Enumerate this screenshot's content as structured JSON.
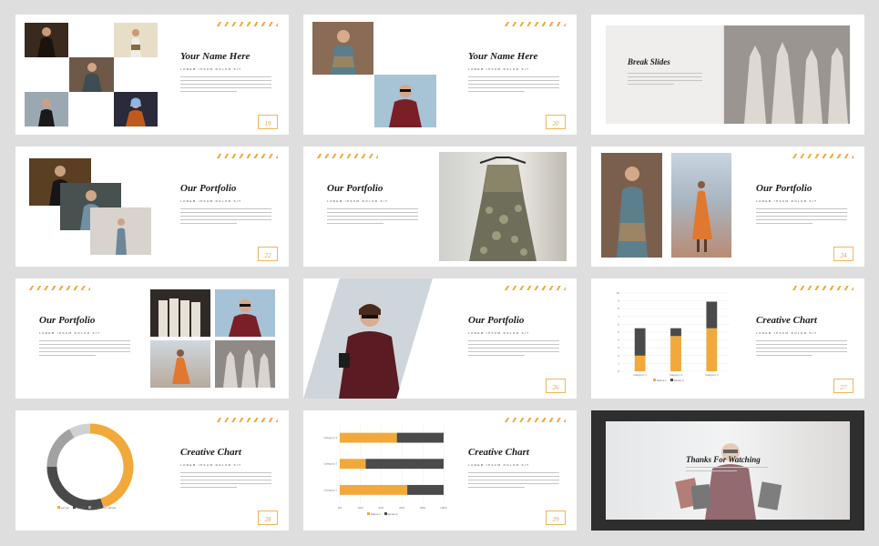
{
  "colors": {
    "accent": "#f2a93b",
    "dark": "#4a4a4a",
    "light": "#cfd3d0",
    "grid": "#ececec"
  },
  "common": {
    "subtitle": "LOREM IPSUM DOLOR SIT"
  },
  "slides": {
    "s1": {
      "title": "Your Name Here",
      "number": "19"
    },
    "s2": {
      "title": "Your Name Here",
      "number": "20"
    },
    "s3": {
      "title": "Break Slides"
    },
    "s4": {
      "title": "Our Portfolio",
      "number": "22"
    },
    "s5": {
      "title": "Our Portfolio"
    },
    "s6": {
      "title": "Our Portfolio",
      "number": "24"
    },
    "s7": {
      "title": "Our Portfolio"
    },
    "s8": {
      "title": "Our Portfolio",
      "number": "26"
    },
    "s9": {
      "title": "Creative Chart",
      "number": "27"
    },
    "s10": {
      "title": "Creative Chart",
      "number": "28"
    },
    "s11": {
      "title": "Creative Chart",
      "number": "29"
    },
    "s12": {
      "title": "Thanks For Watching"
    }
  },
  "chart_data": [
    {
      "type": "bar",
      "stacked": true,
      "categories": [
        "Category 1",
        "Category 2",
        "Category 3"
      ],
      "series": [
        {
          "name": "Series 1",
          "values": [
            2,
            4.5,
            5.5
          ],
          "color": "#f2a93b"
        },
        {
          "name": "Series 2",
          "values": [
            3.5,
            1,
            3.4
          ],
          "color": "#4a4a4a"
        }
      ],
      "ylim": [
        0,
        10
      ],
      "yticks": [
        "0",
        "1",
        "2",
        "3",
        "4",
        "5",
        "6",
        "7",
        "8",
        "9",
        "10"
      ],
      "grid": true,
      "legend": "bottom"
    },
    {
      "type": "pie",
      "donut": true,
      "categories": [
        "1st Qtr",
        "2nd Qtr",
        "3rd Qtr",
        "4th Qtr"
      ],
      "values": [
        45,
        30,
        17,
        8
      ],
      "colors": [
        "#f2a93b",
        "#4a4a4a",
        "#a2a2a2",
        "#cfd3d0"
      ],
      "legend": "bottom"
    },
    {
      "type": "bar",
      "orientation": "horizontal",
      "stacked": true,
      "percent": true,
      "categories": [
        "Category 1",
        "Category 2",
        "Category 3"
      ],
      "series": [
        {
          "name": "Series 1",
          "values": [
            65,
            25,
            55
          ],
          "color": "#f2a93b"
        },
        {
          "name": "Series 2",
          "values": [
            35,
            75,
            45
          ],
          "color": "#4a4a4a"
        }
      ],
      "xticks": [
        "0%",
        "20%",
        "40%",
        "60%",
        "80%",
        "100%"
      ],
      "grid": true,
      "legend": "bottom"
    }
  ]
}
